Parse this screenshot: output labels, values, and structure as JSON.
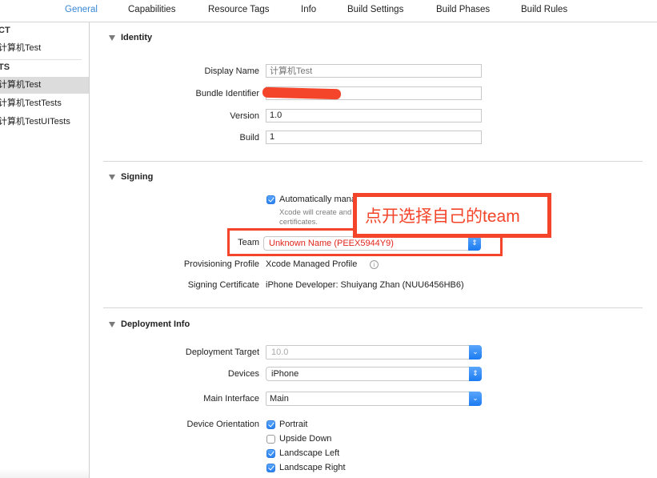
{
  "tabs": [
    {
      "label": "General",
      "active": true
    },
    {
      "label": "Capabilities",
      "active": false
    },
    {
      "label": "Resource Tags",
      "active": false
    },
    {
      "label": "Info",
      "active": false
    },
    {
      "label": "Build Settings",
      "active": false
    },
    {
      "label": "Build Phases",
      "active": false
    },
    {
      "label": "Build Rules",
      "active": false
    }
  ],
  "sidebar": {
    "project_header": "CT",
    "project_item": "计算机Test",
    "targets_header": "TS",
    "targets": [
      {
        "label": "计算机Test",
        "selected": true
      },
      {
        "label": "计算机TestTests",
        "selected": false
      },
      {
        "label": "计算机TestUITests",
        "selected": false
      }
    ]
  },
  "identity": {
    "title": "Identity",
    "display_name_label": "Display Name",
    "display_name_placeholder": "计算机Test",
    "bundle_identifier_label": "Bundle Identifier",
    "bundle_identifier_value": "",
    "version_label": "Version",
    "version_value": "1.0",
    "build_label": "Build",
    "build_value": "1"
  },
  "signing": {
    "title": "Signing",
    "auto_manage_label": "Automatically manage signing",
    "auto_manage_checked": true,
    "auto_manage_hint_line1": "Xcode will create and update profiles, app IDs, and",
    "auto_manage_hint_line2": "certificates.",
    "team_label": "Team",
    "team_value": "Unknown Name (PEEX5944Y9)",
    "provisioning_label": "Provisioning Profile",
    "provisioning_value": "Xcode Managed Profile",
    "certificate_label": "Signing Certificate",
    "certificate_value": "iPhone Developer: Shuiyang Zhan (NUU6456HB6)"
  },
  "annotation": {
    "text": "点开选择自己的team",
    "color": "#f4442a"
  },
  "deployment": {
    "title": "Deployment Info",
    "target_label": "Deployment Target",
    "target_value": "10.0",
    "devices_label": "Devices",
    "devices_value": "iPhone",
    "main_interface_label": "Main Interface",
    "main_interface_value": "Main",
    "orientation_label": "Device Orientation",
    "orientations": [
      {
        "label": "Portrait",
        "checked": true
      },
      {
        "label": "Upside Down",
        "checked": false
      },
      {
        "label": "Landscape Left",
        "checked": true
      },
      {
        "label": "Landscape Right",
        "checked": true
      }
    ]
  },
  "colors": {
    "accent": "#3a87d6",
    "checkbox_blue": "#2a82f0",
    "annotation_red": "#f4442a",
    "team_text_red": "#e0251b"
  }
}
